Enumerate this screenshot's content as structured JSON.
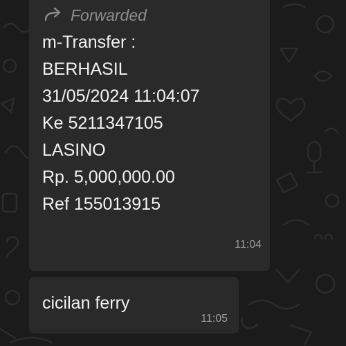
{
  "forwarded_message": {
    "forward_label": "Forwarded",
    "lines": [
      "m-Transfer :",
      "BERHASIL",
      "31/05/2024 11:04:07",
      "Ke 5211347105",
      "LASINO",
      "Rp. 5,000,000.00",
      "Ref 155013915"
    ],
    "time": "11:04"
  },
  "reply_message": {
    "text": "cicilan ferry",
    "time": "11:05"
  },
  "colors": {
    "background": "#1b1b1b",
    "bubble": "#2a2a2a",
    "text": "#f2f2f2",
    "meta": "#9a9a9a"
  },
  "icons": {
    "forward": "forward-arrow-icon",
    "wallpaper": "doodle-wallpaper"
  }
}
